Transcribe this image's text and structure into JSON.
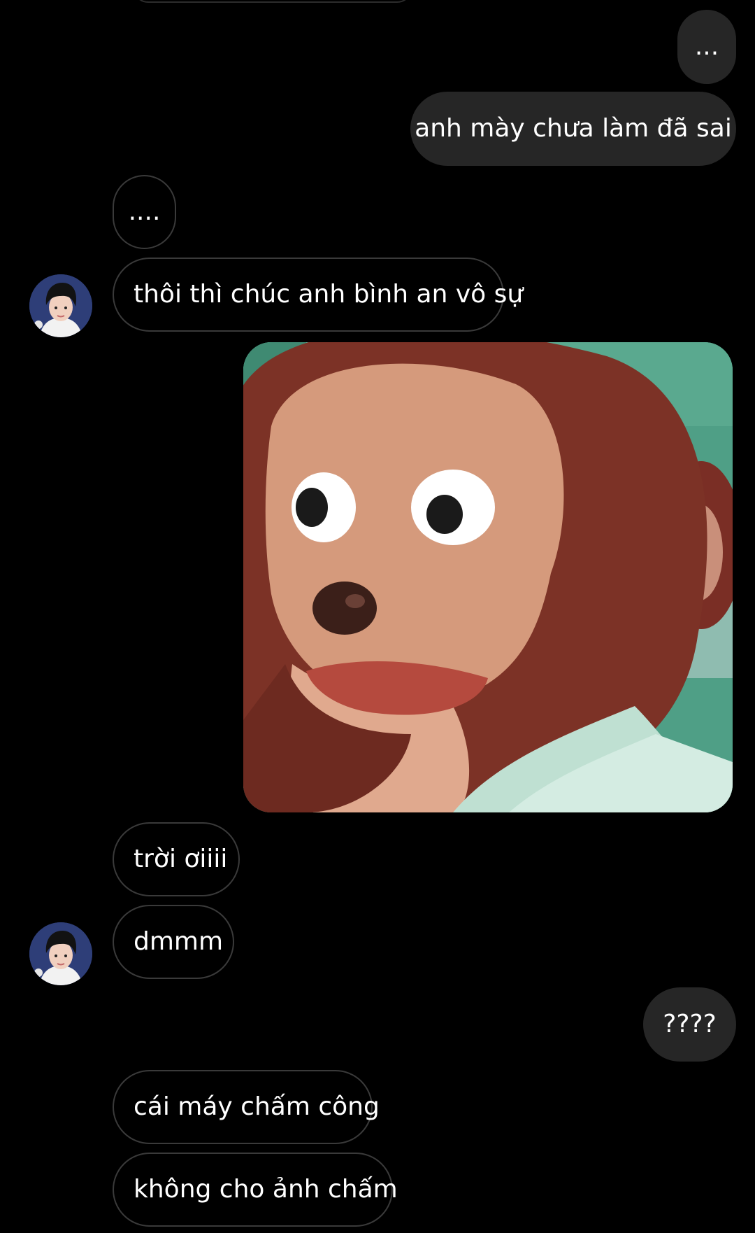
{
  "messages": [
    {
      "direction": "outgoing",
      "text": "..."
    },
    {
      "direction": "outgoing",
      "text": "anh mày chưa làm đã sai"
    },
    {
      "direction": "incoming",
      "text": "...."
    },
    {
      "direction": "incoming",
      "text": "thôi thì chúc anh bình an vô sự"
    },
    {
      "direction": "outgoing",
      "type": "image"
    },
    {
      "direction": "incoming",
      "text": "trời ơiiii"
    },
    {
      "direction": "incoming",
      "text": "dmmm"
    },
    {
      "direction": "outgoing",
      "text": "????"
    },
    {
      "direction": "incoming",
      "text": "cái máy chấm công"
    },
    {
      "direction": "incoming",
      "text": "không cho ảnh chấm"
    }
  ],
  "colors": {
    "background": "#000000",
    "outgoing_bubble": "#262626",
    "incoming_border": "#3a3a3a",
    "text": "#ffffff"
  }
}
